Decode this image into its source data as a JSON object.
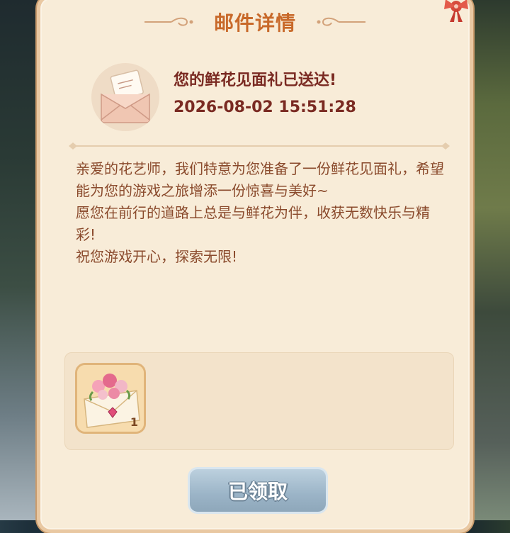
{
  "dialog": {
    "title": "邮件详情"
  },
  "mail": {
    "subject": "您的鲜花见面礼已送达!",
    "datetime": "2026-08-02 15:51:28",
    "paragraphs": [
      "亲爱的花艺师，我们特意为您准备了一份鲜花见面礼，希望能为您的游戏之旅增添一份惊喜与美好~",
      "愿您在前行的道路上总是与鲜花为伴，收获无数快乐与精彩!",
      "祝您游戏开心，探索无限!"
    ]
  },
  "rewards": [
    {
      "icon": "flower-bouquet-envelope-icon",
      "count": "1"
    }
  ],
  "actions": {
    "claimed_label": "已领取"
  },
  "colors": {
    "title": "#c8692a",
    "subject": "#7a2a22",
    "body": "#8a4a2c",
    "panel": "#f8ecd8",
    "button": "#9bb4c7"
  }
}
